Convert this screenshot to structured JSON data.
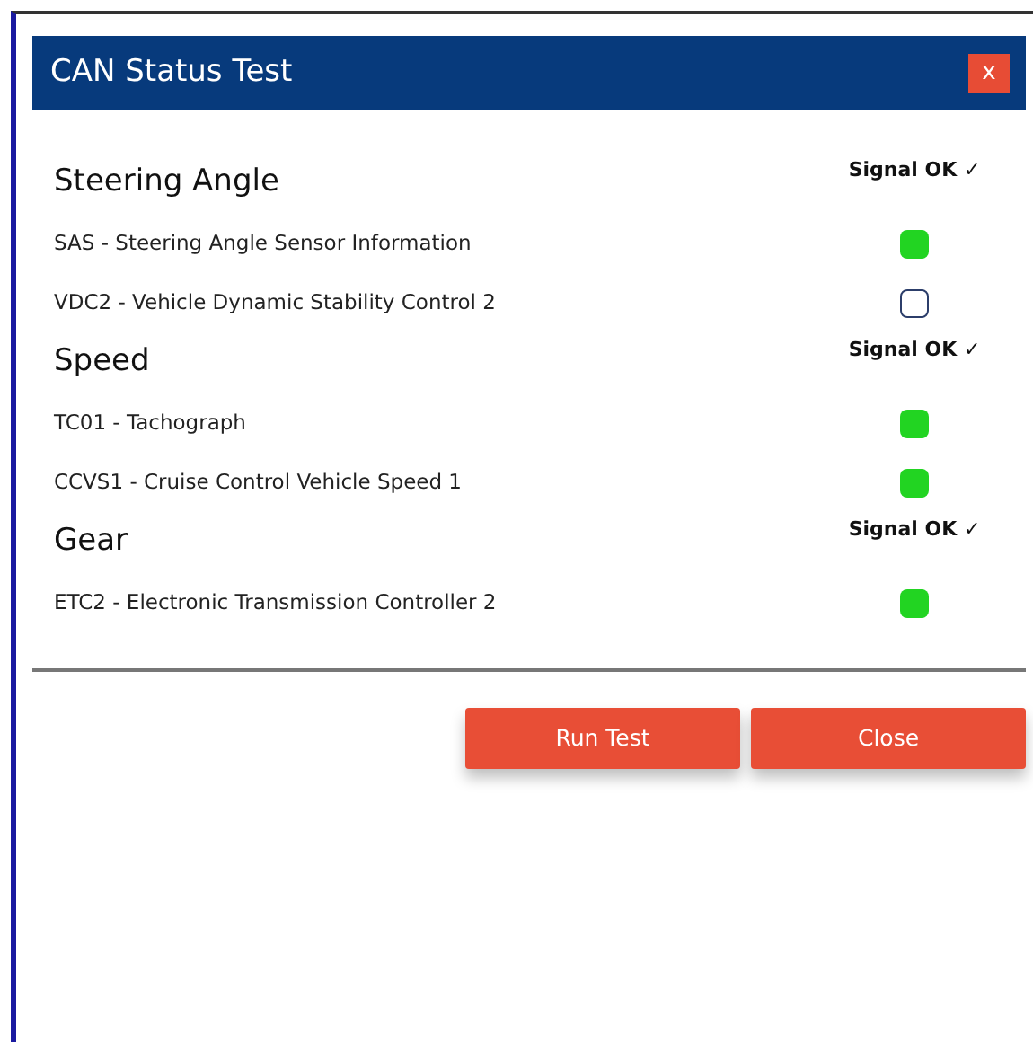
{
  "dialog": {
    "title": "CAN Status Test",
    "close_label": "x"
  },
  "groups": [
    {
      "heading": "Steering Angle",
      "status": "Signal OK ✓",
      "messages": [
        {
          "label": "SAS - Steering Angle Sensor Information",
          "ok": true
        },
        {
          "label": "VDC2 - Vehicle Dynamic Stability Control 2",
          "ok": false
        }
      ]
    },
    {
      "heading": "Speed",
      "status": "Signal OK ✓",
      "messages": [
        {
          "label": "TC01 - Tachograph",
          "ok": true
        },
        {
          "label": "CCVS1 - Cruise Control Vehicle Speed 1",
          "ok": true
        }
      ]
    },
    {
      "heading": "Gear",
      "status": "Signal OK ✓",
      "messages": [
        {
          "label": "ETC2 - Electronic Transmission Controller 2",
          "ok": true
        }
      ]
    }
  ],
  "buttons": [
    "Run Test",
    "Close"
  ]
}
